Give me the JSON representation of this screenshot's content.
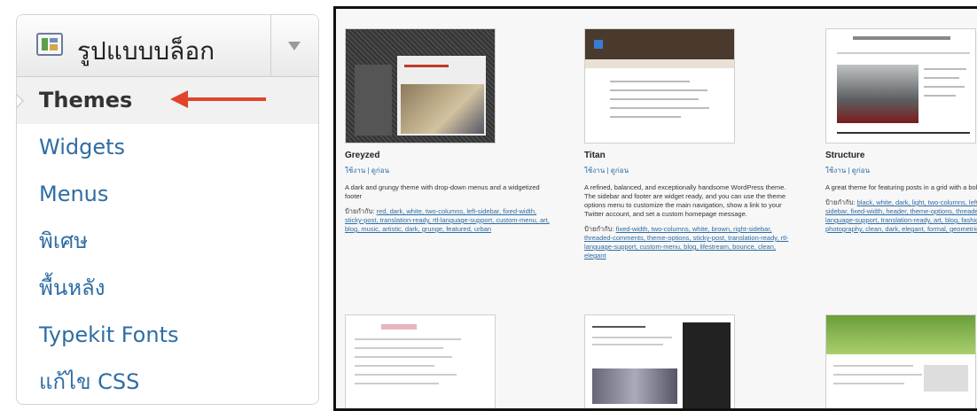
{
  "menu": {
    "title": "รูปแบบบล็อก",
    "icon": "appearance-icon",
    "toggle_icon": "triangle-down-icon",
    "items": [
      {
        "label": "Themes",
        "current": true
      },
      {
        "label": "Widgets"
      },
      {
        "label": "Menus"
      },
      {
        "label": "พิเศษ"
      },
      {
        "label": "พื้นหลัง"
      },
      {
        "label": "Typekit Fonts"
      },
      {
        "label": "แก้ไข CSS"
      }
    ]
  },
  "annotation": {
    "arrow_color": "#e0442b"
  },
  "themes": [
    {
      "name": "Greyzed",
      "actions": "ใช้งาน | ดูก่อน",
      "description": "A dark and grungy theme with drop-down menus and a widgetized footer",
      "tags_label": "ป้ายกำกับ:",
      "tags": "red, dark, white, two-columns, left-sidebar, fixed-width, sticky-post, translation-ready, rtl-language-support, custom-menu, art, blog, music, artistic, dark, grunge, featured, urban"
    },
    {
      "name": "Titan",
      "actions": "ใช้งาน | ดูก่อน",
      "description": "A refined, balanced, and exceptionally handsome WordPress theme. The sidebar and footer are widget ready, and you can use the theme options menu to customize the main navigation, show a link to your Twitter account, and set a custom homepage message.",
      "tags_label": "ป้ายกำกับ:",
      "tags": "fixed-width, two-columns, white, brown, right-sidebar, threaded-comments, theme-options, sticky-post, translation-ready, rtl-language-support, custom-menu, blog, lifestream, bounce, clean, elegant"
    },
    {
      "name": "Structure",
      "actions": "ใช้งาน | ดูก่อน",
      "description": "A great theme for featuring posts in a grid with a bold color scheme.",
      "tags_label": "ป้ายกำกับ:",
      "tags": "black, white, dark, light, two-columns, left-sidebar, right-sidebar, fixed-width, header, theme-options, threaded-comments, rtl-language-support, translation-ready, art, blog, fashion, news, photography, clean, dark, elegant, formal, geometric, modern, urban"
    }
  ],
  "colors": {
    "link": "#2e6da4",
    "frame_border": "#111111"
  }
}
